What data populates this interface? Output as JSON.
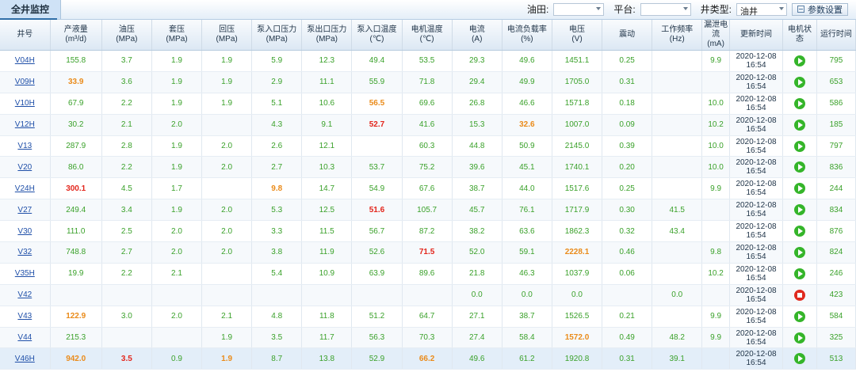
{
  "header": {
    "tab_title": "全井监控",
    "filters": {
      "oilfield_label": "油田:",
      "oilfield_value": "",
      "platform_label": "平台:",
      "platform_value": "",
      "welltype_label": "井类型:",
      "welltype_value": "油井",
      "param_button": "参数设置"
    }
  },
  "table": {
    "columns": [
      {
        "l1": "井号",
        "l2": ""
      },
      {
        "l1": "产液量",
        "l2": "(m³/d)"
      },
      {
        "l1": "油压",
        "l2": "(MPa)"
      },
      {
        "l1": "套压",
        "l2": "(MPa)"
      },
      {
        "l1": "回压",
        "l2": "(MPa)"
      },
      {
        "l1": "泵入口压力",
        "l2": "(MPa)"
      },
      {
        "l1": "泵出口压力",
        "l2": "(MPa)"
      },
      {
        "l1": "泵入口温度",
        "l2": "(℃)"
      },
      {
        "l1": "电机温度",
        "l2": "(℃)"
      },
      {
        "l1": "电流",
        "l2": "(A)"
      },
      {
        "l1": "电流负载率",
        "l2": "(%)"
      },
      {
        "l1": "电压",
        "l2": "(V)"
      },
      {
        "l1": "震动",
        "l2": ""
      },
      {
        "l1": "工作频率",
        "l2": "(Hz)"
      },
      {
        "l1": "漏泄电流",
        "l2": "(mA)"
      },
      {
        "l1": "更新时间",
        "l2": ""
      },
      {
        "l1": "电机状态",
        "l2": ""
      },
      {
        "l1": "运行时间",
        "l2": ""
      }
    ],
    "rows": [
      {
        "well": "V04H",
        "c": [
          "155.8",
          "3.7",
          "1.9",
          "1.9",
          "5.9",
          "12.3",
          "49.4",
          "53.5",
          "29.3",
          "49.6",
          "1451.1",
          "0.25",
          "",
          "9.9"
        ],
        "time": "2020-12-08 16:54",
        "status": "run",
        "runtime": "795"
      },
      {
        "well": "V09H",
        "c": [
          "33.9",
          "3.6",
          "1.9",
          "1.9",
          "2.9",
          "11.1",
          "55.9",
          "71.8",
          "29.4",
          "49.9",
          "1705.0",
          "0.31",
          "",
          ""
        ],
        "time": "2020-12-08 16:54",
        "status": "run",
        "runtime": "653"
      },
      {
        "well": "V10H",
        "c": [
          "67.9",
          "2.2",
          "1.9",
          "1.9",
          "5.1",
          "10.6",
          "56.5",
          "69.6",
          "26.8",
          "46.6",
          "1571.8",
          "0.18",
          "",
          "10.0"
        ],
        "time": "2020-12-08 16:54",
        "status": "run",
        "runtime": "586"
      },
      {
        "well": "V12H",
        "c": [
          "30.2",
          "2.1",
          "2.0",
          "",
          "4.3",
          "9.1",
          "52.7",
          "41.6",
          "15.3",
          "32.6",
          "1007.0",
          "0.09",
          "",
          "10.2"
        ],
        "time": "2020-12-08 16:54",
        "status": "run",
        "runtime": "185"
      },
      {
        "well": "V13",
        "c": [
          "287.9",
          "2.8",
          "1.9",
          "2.0",
          "2.6",
          "12.1",
          "",
          "60.3",
          "44.8",
          "50.9",
          "2145.0",
          "0.39",
          "",
          "10.0"
        ],
        "time": "2020-12-08 16:54",
        "status": "run",
        "runtime": "797"
      },
      {
        "well": "V20",
        "c": [
          "86.0",
          "2.2",
          "1.9",
          "2.0",
          "2.7",
          "10.3",
          "53.7",
          "75.2",
          "39.6",
          "45.1",
          "1740.1",
          "0.20",
          "",
          "10.0"
        ],
        "time": "2020-12-08 16:54",
        "status": "run",
        "runtime": "836"
      },
      {
        "well": "V24H",
        "c": [
          "300.1",
          "4.5",
          "1.7",
          "",
          "9.8",
          "14.7",
          "54.9",
          "67.6",
          "38.7",
          "44.0",
          "1517.6",
          "0.25",
          "",
          "9.9"
        ],
        "time": "2020-12-08 16:54",
        "status": "run",
        "runtime": "244"
      },
      {
        "well": "V27",
        "c": [
          "249.4",
          "3.4",
          "1.9",
          "2.0",
          "5.3",
          "12.5",
          "51.6",
          "105.7",
          "45.7",
          "76.1",
          "1717.9",
          "0.30",
          "41.5",
          ""
        ],
        "time": "2020-12-08 16:54",
        "status": "run",
        "runtime": "834"
      },
      {
        "well": "V30",
        "c": [
          "111.0",
          "2.5",
          "2.0",
          "2.0",
          "3.3",
          "11.5",
          "56.7",
          "87.2",
          "38.2",
          "63.6",
          "1862.3",
          "0.32",
          "43.4",
          ""
        ],
        "time": "2020-12-08 16:54",
        "status": "run",
        "runtime": "876"
      },
      {
        "well": "V32",
        "c": [
          "748.8",
          "2.7",
          "2.0",
          "2.0",
          "3.8",
          "11.9",
          "52.6",
          "71.5",
          "52.0",
          "59.1",
          "2228.1",
          "0.46",
          "",
          "9.8"
        ],
        "time": "2020-12-08 16:54",
        "status": "run",
        "runtime": "824"
      },
      {
        "well": "V35H",
        "c": [
          "19.9",
          "2.2",
          "2.1",
          "",
          "5.4",
          "10.9",
          "63.9",
          "89.6",
          "21.8",
          "46.3",
          "1037.9",
          "0.06",
          "",
          "10.2"
        ],
        "time": "2020-12-08 16:54",
        "status": "run",
        "runtime": "246"
      },
      {
        "well": "V42",
        "c": [
          "",
          "",
          "",
          "",
          "",
          "",
          "",
          "",
          "0.0",
          "0.0",
          "0.0",
          "",
          "0.0",
          ""
        ],
        "time": "2020-12-08 16:54",
        "status": "stop",
        "runtime": "423"
      },
      {
        "well": "V43",
        "c": [
          "122.9",
          "3.0",
          "2.0",
          "2.1",
          "4.8",
          "11.8",
          "51.2",
          "64.7",
          "27.1",
          "38.7",
          "1526.5",
          "0.21",
          "",
          "9.9"
        ],
        "time": "2020-12-08 16:54",
        "status": "run",
        "runtime": "584"
      },
      {
        "well": "V44",
        "c": [
          "215.3",
          "",
          "",
          "1.9",
          "3.5",
          "11.7",
          "56.3",
          "70.3",
          "27.4",
          "58.4",
          "1572.0",
          "0.49",
          "48.2",
          "9.9"
        ],
        "time": "2020-12-08 16:54",
        "status": "run",
        "runtime": "325"
      },
      {
        "well": "V46H",
        "c": [
          "942.0",
          "3.5",
          "0.9",
          "1.9",
          "8.7",
          "13.8",
          "52.9",
          "66.2",
          "49.6",
          "61.2",
          "1920.8",
          "0.31",
          "39.1",
          ""
        ],
        "time": "2020-12-08 16:54",
        "status": "run",
        "runtime": "513"
      }
    ]
  },
  "highlights": {
    "warn": [
      [
        1,
        1
      ],
      [
        2,
        7
      ],
      [
        3,
        10
      ],
      [
        6,
        5
      ],
      [
        9,
        11
      ],
      [
        12,
        1
      ],
      [
        13,
        11
      ],
      [
        14,
        1
      ],
      [
        14,
        4
      ],
      [
        14,
        8
      ]
    ],
    "alarm": [
      [
        3,
        7
      ],
      [
        6,
        1
      ],
      [
        6,
        4
      ],
      [
        7,
        7
      ],
      [
        9,
        8
      ],
      [
        14,
        2
      ]
    ]
  },
  "colors": {
    "normal": "#3aa12a",
    "warn": "#ea8b1a",
    "alarm": "#e3261c",
    "link": "#1f4fa8"
  },
  "selected_row": 14
}
